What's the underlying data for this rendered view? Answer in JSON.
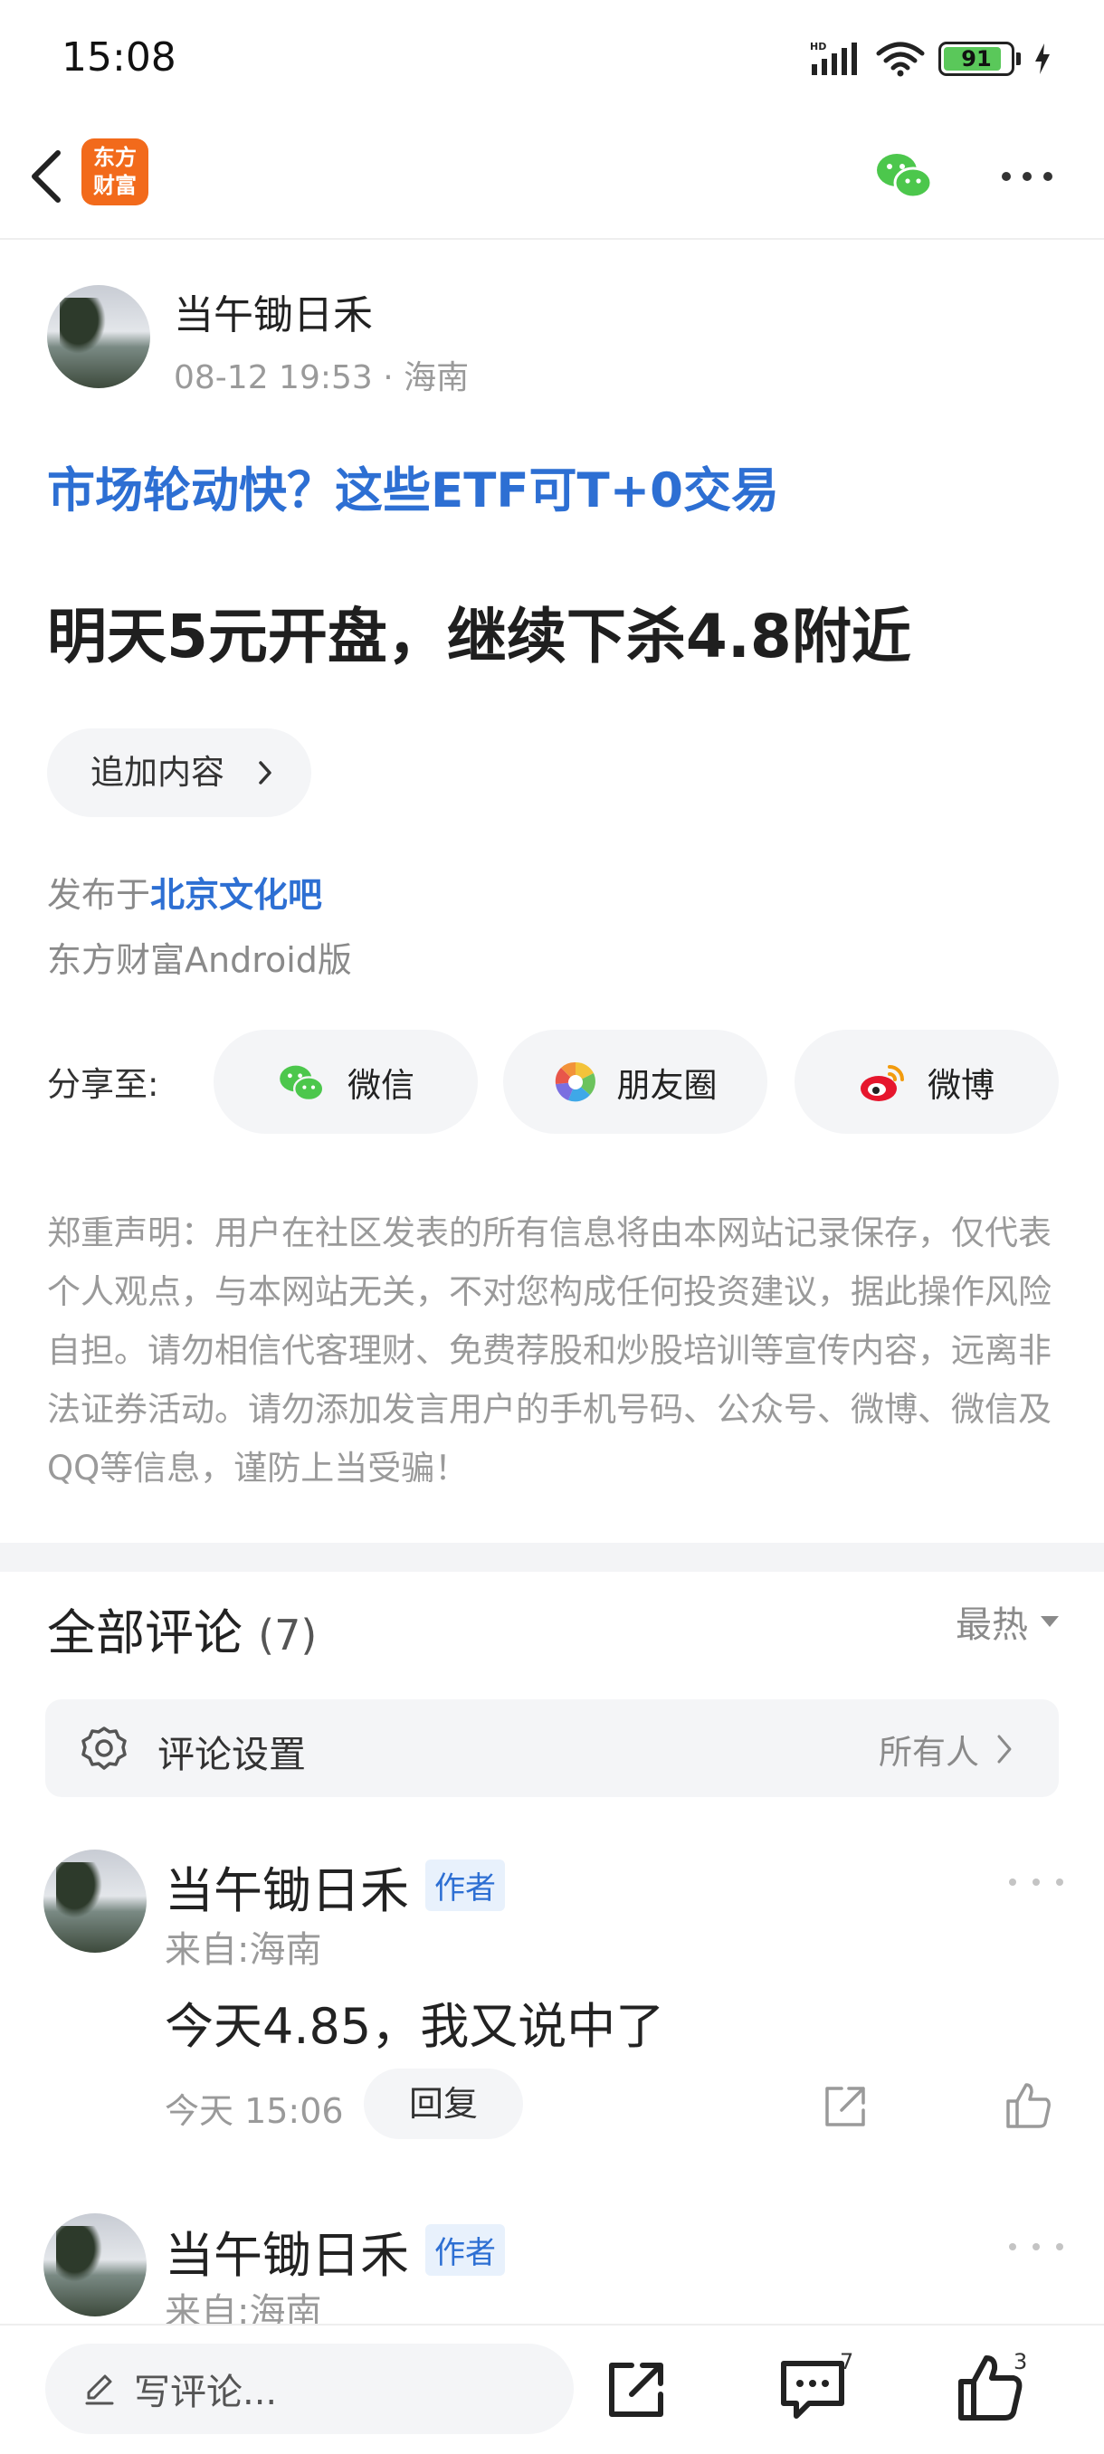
{
  "status_bar": {
    "time": "15:08",
    "battery": "91",
    "network": "HD"
  },
  "header": {
    "logo_line1": "东方",
    "logo_line2": "财富"
  },
  "post": {
    "author_name": "当午锄日禾",
    "time": "08-12 19:53",
    "location": "海南",
    "topic_link": "市场轮动快？这些ETF可T+0交易",
    "title": "明天5元开盘，继续下杀4.8附近",
    "append_label": "追加内容",
    "published_prefix": "发布于",
    "board": "北京文化吧",
    "client": "东方财富Android版"
  },
  "share": {
    "label": "分享至:",
    "targets": [
      "微信",
      "朋友圈",
      "微博"
    ]
  },
  "disclaimer": "郑重声明：用户在社区发表的所有信息将由本网站记录保存，仅代表个人观点，与本网站无关，不对您构成任何投资建议，据此操作风险自担。请勿相信代客理财、免费荐股和炒股培训等宣传内容，远离非法证券活动。请勿添加发言用户的手机号码、公众号、微博、微信及QQ等信息，谨防上当受骗！",
  "comments": {
    "title": "全部评论",
    "count": "(7)",
    "sort": "最热",
    "settings_label": "评论设置",
    "settings_value": "所有人",
    "items": [
      {
        "name": "当午锄日禾",
        "badge": "作者",
        "from": "来自:海南",
        "text": "今天4.85，我又说中了",
        "time": "今天 15:06",
        "reply": "回复"
      },
      {
        "name": "当午锄日禾",
        "badge": "作者",
        "from": "来自:海南"
      }
    ]
  },
  "bottom_bar": {
    "placeholder": "写评论...",
    "comment_count": "7",
    "like_count": "3"
  },
  "colors": {
    "accent_blue": "#2d6fd3",
    "brand_orange": "#f26a1b",
    "wechat_green": "#4cc74c"
  }
}
